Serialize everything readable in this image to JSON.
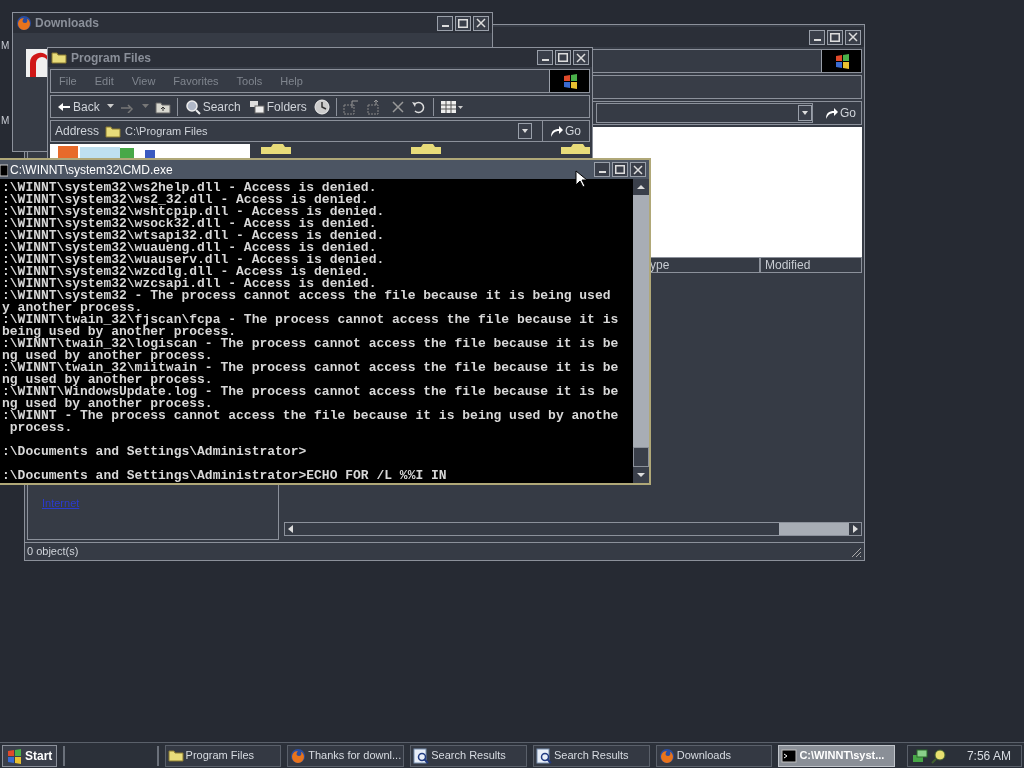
{
  "desktop_fragments": [
    "M",
    "M"
  ],
  "back_window": {
    "go_button": "Go",
    "columns": [
      "ype",
      "Modified"
    ],
    "link": "Internet",
    "status": "0 object(s)"
  },
  "downloads_window": {
    "title": "Downloads"
  },
  "program_files_window": {
    "title": "Program Files",
    "menu": [
      "File",
      "Edit",
      "View",
      "Favorites",
      "Tools",
      "Help"
    ],
    "back_button": "Back",
    "search_button": "Search",
    "folders_button": "Folders",
    "address_label": "Address",
    "address": "C:\\Program Files",
    "go_button": "Go"
  },
  "cmd_window": {
    "title": "C:\\WINNT\\system32\\CMD.exe",
    "lines": [
      {
        "kind": "output",
        "text": ":\\WINNT\\system32\\ws2help.dll - Access is denied."
      },
      {
        "kind": "output",
        "text": ":\\WINNT\\system32\\ws2_32.dll - Access is denied."
      },
      {
        "kind": "output",
        "text": ":\\WINNT\\system32\\wshtcpip.dll - Access is denied."
      },
      {
        "kind": "output",
        "text": ":\\WINNT\\system32\\wsock32.dll - Access is denied."
      },
      {
        "kind": "output",
        "text": ":\\WINNT\\system32\\wtsapi32.dll - Access is denied."
      },
      {
        "kind": "output",
        "text": ":\\WINNT\\system32\\wuaueng.dll - Access is denied."
      },
      {
        "kind": "output",
        "text": ":\\WINNT\\system32\\wuauserv.dll - Access is denied."
      },
      {
        "kind": "output",
        "text": ":\\WINNT\\system32\\wzcdlg.dll - Access is denied."
      },
      {
        "kind": "output",
        "text": ":\\WINNT\\system32\\wzcsapi.dll - Access is denied."
      },
      {
        "kind": "output",
        "text": ":\\WINNT\\system32 - The process cannot access the file because it is being used"
      },
      {
        "kind": "output",
        "text": "y another process."
      },
      {
        "kind": "output",
        "text": ":\\WINNT\\twain_32\\fjscan\\fcpa - The process cannot access the file because it is"
      },
      {
        "kind": "output",
        "text": "being used by another process."
      },
      {
        "kind": "output",
        "text": ":\\WINNT\\twain_32\\logiscan - The process cannot access the file because it is be"
      },
      {
        "kind": "output",
        "text": "ng used by another process."
      },
      {
        "kind": "output",
        "text": ":\\WINNT\\twain_32\\miitwain - The process cannot access the file because it is be"
      },
      {
        "kind": "output",
        "text": "ng used by another process."
      },
      {
        "kind": "output",
        "text": ":\\WINNT\\WindowsUpdate.log - The process cannot access the file because it is be"
      },
      {
        "kind": "output",
        "text": "ng used by another process."
      },
      {
        "kind": "output",
        "text": ":\\WINNT - The process cannot access the file because it is being used by anothe"
      },
      {
        "kind": "output",
        "text": " process."
      },
      {
        "kind": "prompt",
        "text": ":\\Documents and Settings\\Administrator>"
      },
      {
        "kind": "prompt",
        "text": ":\\Documents and Settings\\Administrator>ECHO FOR /L %%I IN"
      }
    ]
  },
  "taskbar": {
    "start": "Start",
    "tasks": [
      {
        "label": "Program Files",
        "kind": "folder",
        "selected": false
      },
      {
        "label": "Thanks for downl...",
        "kind": "firefox",
        "selected": false
      },
      {
        "label": "Search Results",
        "kind": "search",
        "selected": false
      },
      {
        "label": "Search Results",
        "kind": "search",
        "selected": false
      },
      {
        "label": "Downloads",
        "kind": "firefox",
        "selected": false
      },
      {
        "label": "C:\\WINNT\\syst...",
        "kind": "console",
        "selected": true
      }
    ],
    "clock": "7:56 AM"
  }
}
